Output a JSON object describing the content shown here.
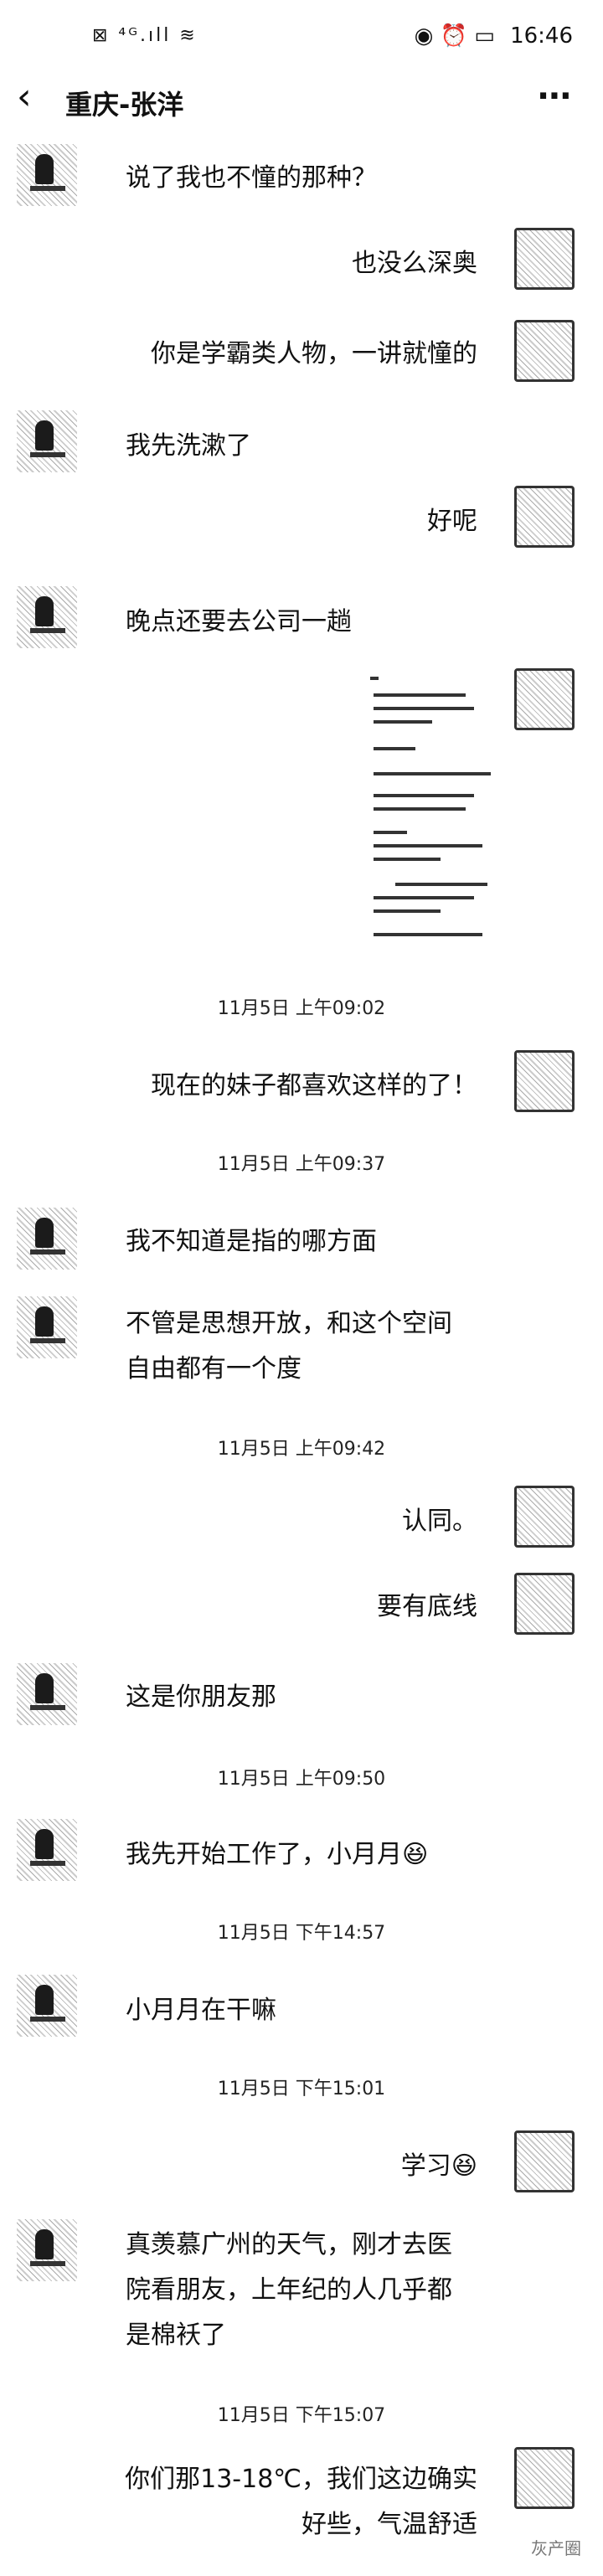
{
  "status_bar": {
    "left_icons": "⊠ ⁴ᴳ.ıll ≋",
    "right_icons": "◉ ⏰ ▭",
    "time": "16:46"
  },
  "header": {
    "title": "重庆-张洋",
    "back_icon": "chevron-left-icon",
    "more_icon": "more-horizontal-icon"
  },
  "messages": [
    {
      "side": "left",
      "text": "说了我也不憧的那种？"
    },
    {
      "side": "right",
      "text": "也没么深奥"
    },
    {
      "side": "right",
      "text": "你是学霸类人物，一讲就憧的"
    },
    {
      "side": "left",
      "text": "我先洗漱了"
    },
    {
      "side": "right",
      "text": "好呢"
    },
    {
      "side": "left",
      "text": "晚点还要去公司一趟"
    },
    {
      "side": "right",
      "type": "document-image"
    },
    {
      "side": "right",
      "text": "现在的妹子都喜欢这样的了！"
    },
    {
      "side": "left",
      "text": "我不知道是指的哪方面"
    },
    {
      "side": "left",
      "lines": [
        "不管是思想开放，和这个空间",
        "自由都有一个度"
      ]
    },
    {
      "side": "right",
      "text": "认同。"
    },
    {
      "side": "right",
      "text": "要有底线"
    },
    {
      "side": "left",
      "text": "这是你朋友那"
    },
    {
      "side": "left",
      "text": "我先开始工作了，小月月",
      "emoji": "😆"
    },
    {
      "side": "left",
      "text": "小月月在干嘛"
    },
    {
      "side": "right",
      "text": "学习",
      "emoji": "😆"
    },
    {
      "side": "left",
      "lines": [
        "真羡慕广州的天气，刚才去医",
        "院看朋友，上年纪的人几乎都",
        "是棉袄了"
      ]
    },
    {
      "side": "right",
      "lines": [
        "你们那13-18℃，我们这边确实",
        "好些，气温舒适"
      ]
    }
  ],
  "timestamps": [
    "11月5日 上午09:02",
    "11月5日 上午09:37",
    "11月5日 上午09:42",
    "11月5日 上午09:50",
    "11月5日 下午14:57",
    "11月5日 下午15:01",
    "11月5日 下午15:07"
  ],
  "watermark": "灰产圈"
}
